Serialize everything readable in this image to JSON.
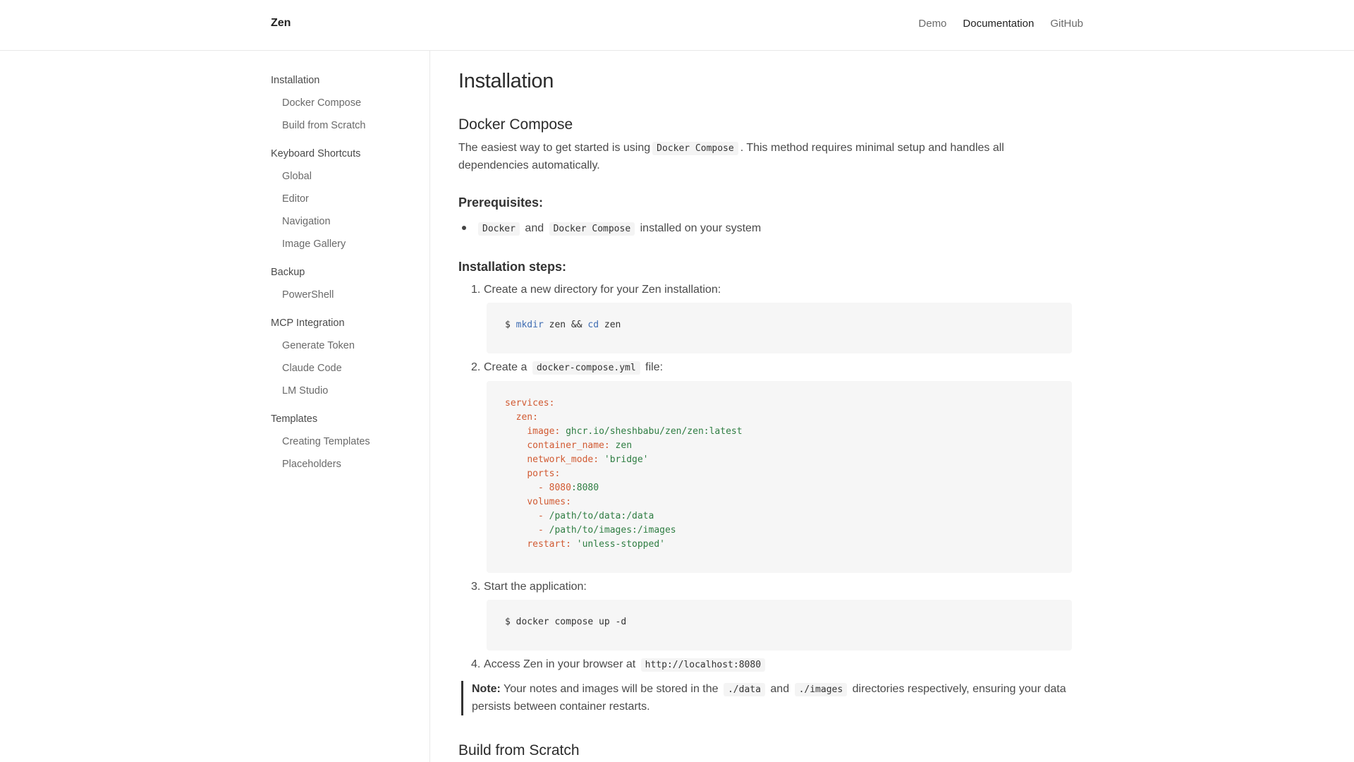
{
  "header": {
    "brand": "Zen",
    "nav": [
      "Demo",
      "Documentation",
      "GitHub"
    ]
  },
  "sidebar": {
    "groups": [
      {
        "heading": "Installation",
        "items": [
          "Docker Compose",
          "Build from Scratch"
        ]
      },
      {
        "heading": "Keyboard Shortcuts",
        "items": [
          "Global",
          "Editor",
          "Navigation",
          "Image Gallery"
        ]
      },
      {
        "heading": "Backup",
        "items": [
          "PowerShell"
        ]
      },
      {
        "heading": "MCP Integration",
        "items": [
          "Generate Token",
          "Claude Code",
          "LM Studio"
        ]
      },
      {
        "heading": "Templates",
        "items": [
          "Creating Templates",
          "Placeholders"
        ]
      }
    ]
  },
  "content": {
    "title": "Installation",
    "docker_heading": "Docker Compose",
    "intro_pre": "The easiest way to get started is using",
    "intro_code": "Docker Compose",
    "intro_post": ". This method requires minimal setup and handles all",
    "intro_line2": "dependencies automatically.",
    "prereq_heading": "Prerequisites:",
    "prereq_code1": "Docker",
    "prereq_and": "and",
    "prereq_code2": "Docker Compose",
    "prereq_post": "installed on your system",
    "steps_heading": "Installation steps:",
    "step1_num": "1.",
    "step1": "Create a new directory for your Zen installation:",
    "code1_prompt": "$",
    "code1_cmd1": "mkdir",
    "code1_mid": "zen &&",
    "code1_cmd2": "cd",
    "code1_end": "zen",
    "step2_num": "2.",
    "step2_pre": "Create a",
    "step2_code": "docker-compose.yml",
    "step2_post": "file:",
    "yaml": {
      "services": "services:",
      "zen": "zen:",
      "image_key": "image:",
      "image_val": "ghcr.io/sheshbabu/zen/zen:latest",
      "cname_key": "container_name:",
      "cname_val": "zen",
      "net_key": "network_mode:",
      "net_val": "'bridge'",
      "ports_key": "ports:",
      "port_dash": "- ",
      "port_a": "8080",
      "port_b": ":8080",
      "vol_key": "volumes:",
      "vol1": "/path/to/data:/data",
      "vol2": "/path/to/images:/images",
      "restart_key": "restart:",
      "restart_val": "'unless-stopped'"
    },
    "step3_num": "3.",
    "step3": "Start the application:",
    "code3": "$ docker compose up -d",
    "step4_num": "4.",
    "step4_pre": "Access Zen in your browser at",
    "step4_code": "http://localhost:8080",
    "note_label": "Note:",
    "note_pre": "Your notes and images will be stored in the",
    "note_code1": "./data",
    "note_and": "and",
    "note_code2": "./images",
    "note_post": "directories respectively, ensuring your data",
    "note_line2": "persists between container restarts.",
    "build_heading": "Build from Scratch"
  }
}
